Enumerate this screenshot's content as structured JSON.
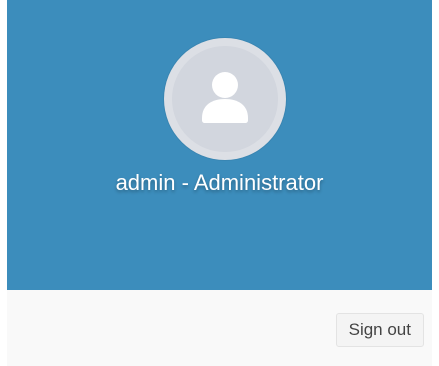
{
  "user_menu": {
    "user_display": "admin - Administrator",
    "avatar_icon": "user-icon",
    "signout_label": "Sign out"
  },
  "colors": {
    "header_background": "#3c8dbc",
    "avatar_background": "#d2d6de",
    "footer_background": "#f9f9f9"
  }
}
